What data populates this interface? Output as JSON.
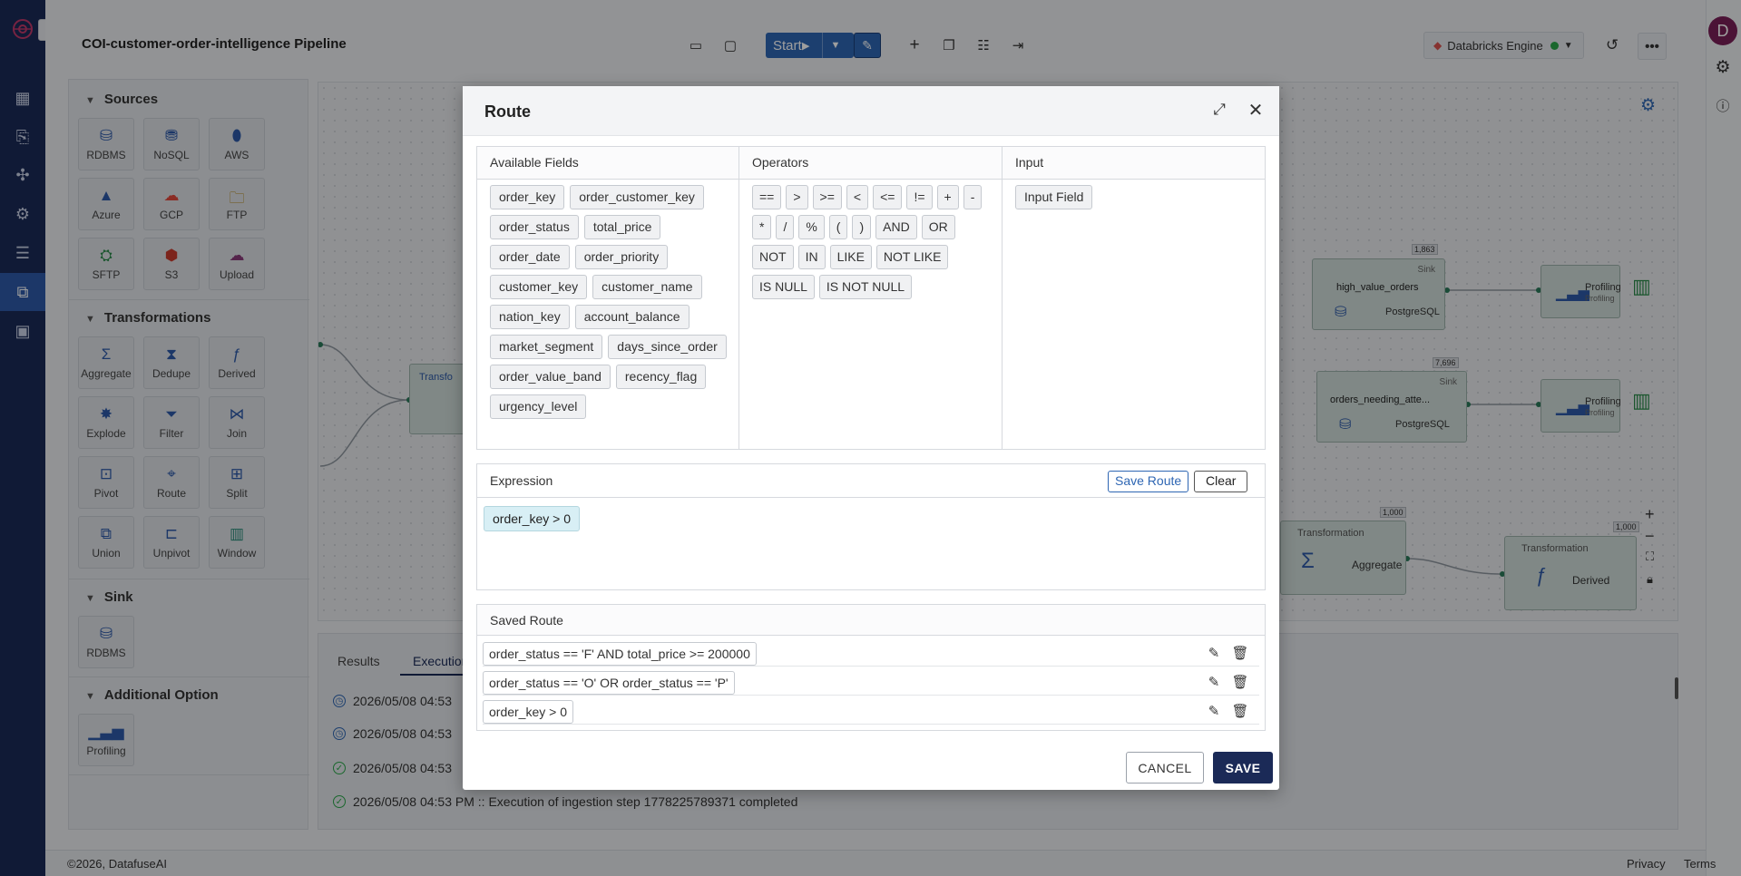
{
  "header": {
    "pipeline_title": "COI-customer-order-intelligence Pipeline",
    "start_label": "Start",
    "engine_label": "Databricks Engine"
  },
  "user": {
    "avatar_letter": "D"
  },
  "sidebar": {
    "sources_title": "Sources",
    "sources": [
      "RDBMS",
      "NoSQL",
      "AWS",
      "Azure",
      "GCP",
      "FTP",
      "SFTP",
      "S3",
      "Upload"
    ],
    "transformations_title": "Transformations",
    "transformations": [
      "Aggregate",
      "Dedupe",
      "Derived",
      "Explode",
      "Filter",
      "Join",
      "Pivot",
      "Route",
      "Split",
      "Union",
      "Unpivot",
      "Window"
    ],
    "sink_title": "Sink",
    "sinks": [
      "RDBMS"
    ],
    "additional_title": "Additional Option",
    "additional": [
      "Profiling"
    ]
  },
  "canvas": {
    "nodes": [
      {
        "badge": "Sink",
        "name": "high_value_orders",
        "db": "PostgreSQL",
        "count": "1,863"
      },
      {
        "badge": "Sink",
        "name": "orders_needing_atte...",
        "db": "PostgreSQL",
        "count": "7,696"
      }
    ],
    "profiling": [
      {
        "title": "Profiling",
        "sub": "Profiling"
      },
      {
        "title": "Profiling",
        "sub": "Profiling"
      }
    ],
    "transforms": [
      {
        "badge": "Transformation",
        "name": "Aggregate",
        "count": "1,000"
      },
      {
        "badge": "Transformation",
        "name": "Derived",
        "count": "1,000"
      }
    ],
    "partial_node_label": "Transfo"
  },
  "bottom": {
    "tabs": [
      "Results",
      "Execution"
    ],
    "logs": [
      "2026/05/08 04:53",
      "2026/05/08 04:53",
      "2026/05/08 04:53",
      "2026/05/08 04:53 PM :: Execution of ingestion step 1778225789371 completed"
    ]
  },
  "footer": {
    "copyright": "©2026, DatafuseAI",
    "privacy": "Privacy",
    "terms": "Terms"
  },
  "modal": {
    "title": "Route",
    "columns": {
      "fields_title": "Available Fields",
      "operators_title": "Operators",
      "input_title": "Input"
    },
    "fields": [
      "order_key",
      "order_customer_key",
      "order_status",
      "total_price",
      "order_date",
      "order_priority",
      "customer_key",
      "customer_name",
      "nation_key",
      "account_balance",
      "market_segment",
      "days_since_order",
      "order_value_band",
      "recency_flag",
      "urgency_level"
    ],
    "operators": [
      "==",
      ">",
      ">=",
      "<",
      "<=",
      "!=",
      "+",
      "-",
      "*",
      "/",
      "%",
      "(",
      ")",
      "AND",
      "OR",
      "NOT",
      "IN",
      "LIKE",
      "NOT LIKE",
      "IS NULL",
      "IS NOT NULL"
    ],
    "input_field": "Input Field",
    "expression_title": "Expression",
    "save_route_label": "Save Route",
    "clear_label": "Clear",
    "expression": "order_key > 0",
    "saved_title": "Saved Route",
    "saved_routes": [
      "order_status == 'F' AND total_price >= 200000",
      "order_status == 'O' OR order_status == 'P'",
      "order_key > 0"
    ],
    "cancel_label": "CANCEL",
    "save_label": "SAVE"
  },
  "colors": {
    "brand_navy": "#1b2a57",
    "primary_blue": "#2e66b3",
    "status_green": "#2aa74a",
    "expression_chip_bg": "#d8eff5"
  }
}
